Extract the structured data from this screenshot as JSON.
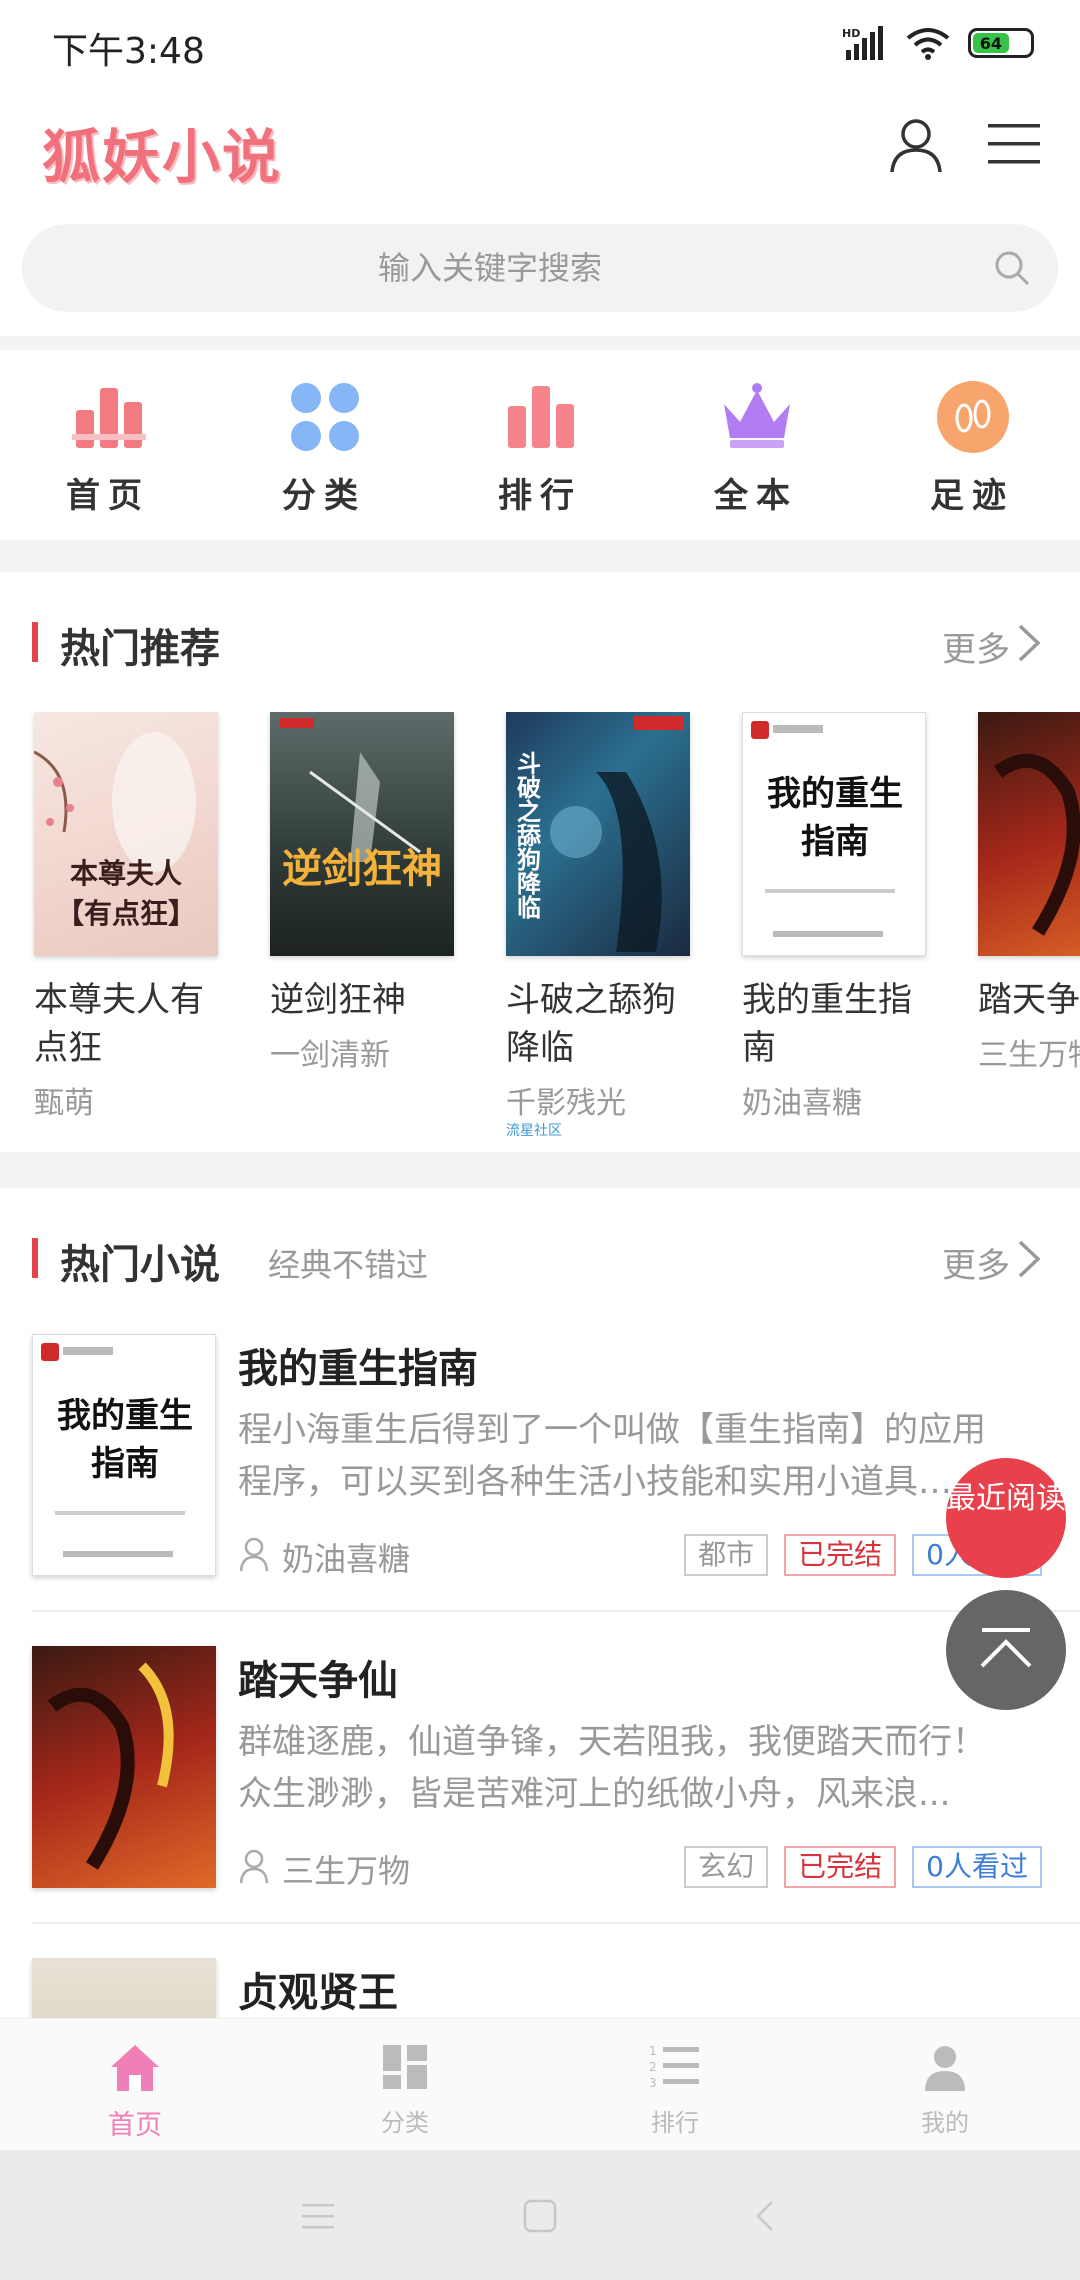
{
  "status_bar": {
    "time": "下午3:48",
    "network": "HD",
    "battery": "64"
  },
  "header": {
    "logo": "狐妖小说"
  },
  "search": {
    "placeholder": "输入关键字搜索"
  },
  "nav": [
    {
      "label": "首页",
      "icon": "bar-chart-icon"
    },
    {
      "label": "分类",
      "icon": "grid-dots-icon"
    },
    {
      "label": "排行",
      "icon": "ranking-icon"
    },
    {
      "label": "全本",
      "icon": "crown-icon"
    },
    {
      "label": "足迹",
      "icon": "footprint-icon"
    }
  ],
  "hot_recommend": {
    "title": "热门推荐",
    "more": "更多",
    "books": [
      {
        "name": "本尊夫人有点狂",
        "author": "甄萌",
        "cover_text": "本尊夫人【有点狂】"
      },
      {
        "name": "逆剑狂神",
        "author": "一剑清新",
        "cover_text": "逆剑狂神"
      },
      {
        "name": "斗破之舔狗降临",
        "author": "千影残光",
        "cover_text": "斗破之舔狗降临",
        "badge": "流星社区"
      },
      {
        "name": "我的重生指南",
        "author": "奶油喜糖",
        "cover_text": "我的重生指南"
      },
      {
        "name": "踏天争仙",
        "author": "三生万物",
        "cover_text": ""
      }
    ]
  },
  "hot_novels": {
    "title": "热门小说",
    "subtitle": "经典不错过",
    "more": "更多",
    "items": [
      {
        "title": "我的重生指南",
        "desc": "程小海重生后得到了一个叫做【重生指南】的应用程序，可以买到各种生活小技能和实用小道具……",
        "author": "奶油喜糖",
        "genre": "都市",
        "status": "已完结",
        "views": "0人看过"
      },
      {
        "title": "踏天争仙",
        "desc": "群雄逐鹿，仙道争锋，天若阻我，我便踏天而行！众生渺渺，皆是苦难河上的纸做小舟，风来浪...",
        "author": "三生万物",
        "genre": "玄幻",
        "status": "已完结",
        "views": "0人看过"
      },
      {
        "title": "贞观贤王"
      }
    ]
  },
  "floating": {
    "recent_read": "最近阅读"
  },
  "tabbar": [
    {
      "label": "首页",
      "active": true
    },
    {
      "label": "分类"
    },
    {
      "label": "排行"
    },
    {
      "label": "我的"
    }
  ],
  "colors": {
    "accent": "#e8414c",
    "brand": "#f0717b",
    "tab_active": "#f07fb7"
  }
}
